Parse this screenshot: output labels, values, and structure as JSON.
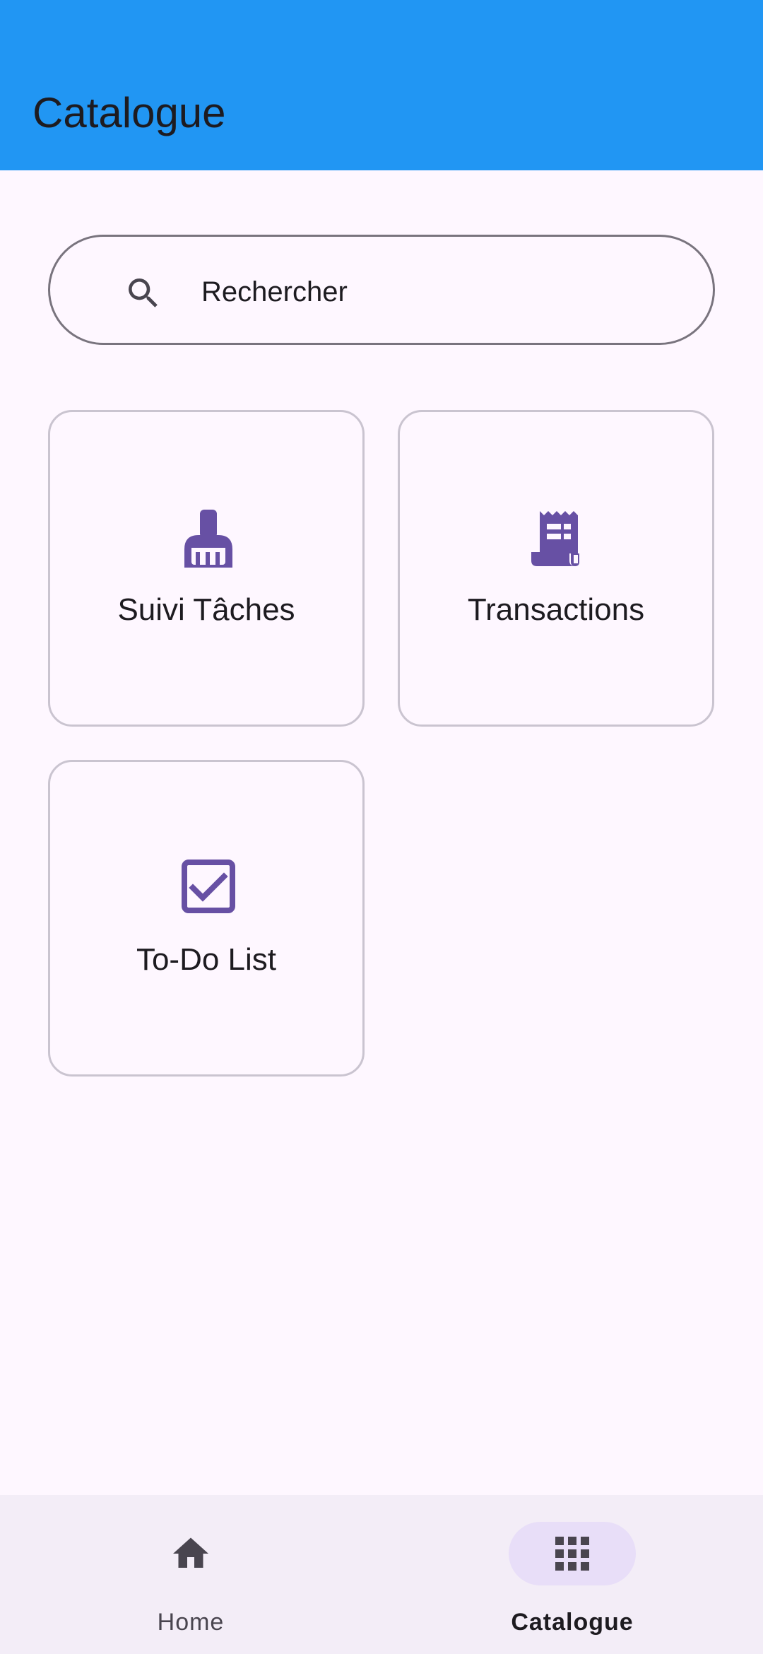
{
  "app_bar": {
    "title": "Catalogue",
    "color": "#2196f3"
  },
  "search": {
    "placeholder": "Rechercher",
    "icon": "search-icon"
  },
  "catalogue": {
    "items": [
      {
        "label": "Suivi Tâches",
        "icon": "broom-icon"
      },
      {
        "label": "Transactions",
        "icon": "receipt-icon"
      },
      {
        "label": "To-Do List",
        "icon": "checkbox-icon"
      }
    ],
    "icon_color": "#6750a4"
  },
  "bottom_nav": {
    "items": [
      {
        "label": "Home",
        "icon": "home-icon",
        "active": false
      },
      {
        "label": "Catalogue",
        "icon": "apps-grid-icon",
        "active": true
      }
    ],
    "active_indicator_color": "#e8def8"
  }
}
